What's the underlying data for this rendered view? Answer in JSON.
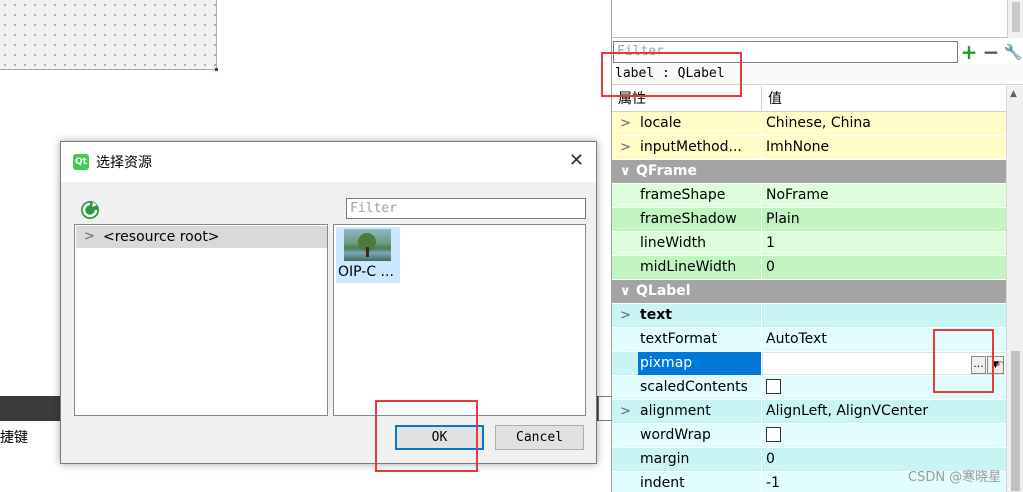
{
  "property_editor": {
    "filter_placeholder": "Filter",
    "object_label": "label : QLabel",
    "header": {
      "property": "属性",
      "value": "值"
    },
    "rows": [
      {
        "name": "locale",
        "value": "Chinese, China"
      },
      {
        "name": "inputMethod...",
        "value": "ImhNone"
      },
      {
        "name": "QFrame"
      },
      {
        "name": "frameShape",
        "value": "NoFrame"
      },
      {
        "name": "frameShadow",
        "value": "Plain"
      },
      {
        "name": "lineWidth",
        "value": "1"
      },
      {
        "name": "midLineWidth",
        "value": "0"
      },
      {
        "name": "QLabel"
      },
      {
        "name": "text",
        "value": ""
      },
      {
        "name": "textFormat",
        "value": "AutoText"
      },
      {
        "name": "pixmap",
        "value": "..."
      },
      {
        "name": "scaledContents",
        "value": ""
      },
      {
        "name": "alignment",
        "value": "AlignLeft, AlignVCenter"
      },
      {
        "name": "wordWrap",
        "value": ""
      },
      {
        "name": "margin",
        "value": "0"
      },
      {
        "name": "indent",
        "value": "-1"
      }
    ]
  },
  "dialog": {
    "title": "选择资源",
    "filter_placeholder": "Filter",
    "tree_items": [
      "<resource root>"
    ],
    "files": [
      "OIP-C ..."
    ],
    "ok_label": "OK",
    "cancel_label": "Cancel"
  },
  "background": {
    "shortcut_label": "捷键"
  },
  "watermark": "CSDN @寒晓星",
  "colors": {
    "annotation_red": "#e8393c",
    "selection_blue": "#0078d7",
    "section_gray": "#a4a4a4",
    "row_yellow": "#fffcc8",
    "row_green": "#dcfcdc",
    "row_cyan": "#e0fcfc"
  }
}
